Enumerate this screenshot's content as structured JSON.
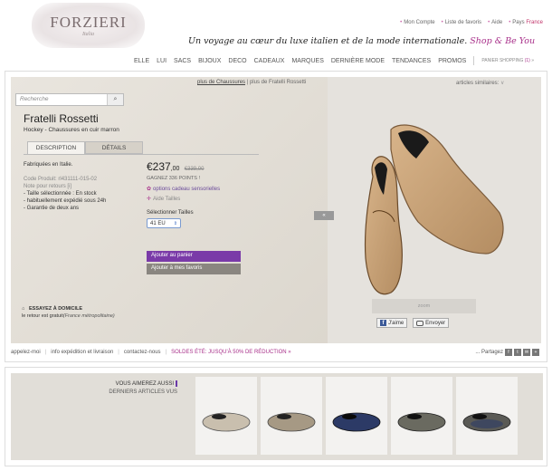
{
  "header": {
    "logo_name": "FORZIERI",
    "logo_sub": "Italia",
    "util_links": [
      "Mon Compte",
      "Liste de favoris",
      "Aide"
    ],
    "country_label": "Pays",
    "country_value": "France",
    "tagline": "Un voyage au cœur du luxe italien et de la mode internationale.",
    "tagline_accent": "Shop & Be You"
  },
  "nav": {
    "items": [
      "ELLE",
      "LUI",
      "SACS",
      "BIJOUX",
      "DECO",
      "CADEAUX",
      "MARQUES",
      "DERNIÈRE MODE",
      "TENDANCES",
      "PROMOS"
    ],
    "shipping_label": "PANIER SHOPPING",
    "shipping_count": "(1)"
  },
  "search": {
    "placeholder": "Recherche"
  },
  "breadcrumb": {
    "parent": "plus de Chaussures",
    "current": "plus de Fratelli Rossetti"
  },
  "similar": {
    "label": "articles similaires:"
  },
  "product": {
    "brand": "Fratelli Rossetti",
    "subtitle": "Hockey - Chaussures en cuir marron",
    "tabs": [
      "DESCRIPTION",
      "DÉTAILS"
    ],
    "made_in": "Fabriquées en Italie.",
    "code_label": "Code Produit:",
    "code_value": "rl431111-015-02",
    "return_note": "Note pour retours [i]",
    "bullets": [
      "- Taille sélectionnée : En stock",
      "- habituellement expédié sous 24h",
      "- Garantie de deux ans"
    ],
    "price_main": "€237",
    "price_cents": ",00",
    "price_old": "€339,00",
    "points": "GAGNEZ 336 POINTS !",
    "gift": "options cadeau sensorielles",
    "size_help": "Aide Tailles",
    "size_label": "Sélectionner Tailles",
    "size_value": "41 EU",
    "add_to_cart": "Ajouter au panier",
    "add_to_fav": "Ajouter à mes favoris",
    "home_title": "ESSAYEZ À DOMICILE",
    "home_text": "le retour est gratuit",
    "home_italic": "(France métropolitaine)"
  },
  "image_panel": {
    "collapse": "«",
    "zoom": "zoom",
    "like": "J'aime",
    "send": "Envoyer"
  },
  "footer": {
    "links": [
      "appelez-moi",
      "info expédition et livraison",
      "contactez-nous"
    ],
    "promo": "SOLDES ÉTÉ: JUSQU'À 50% DE RÉDUCTION »",
    "share": "... Partagez"
  },
  "strip": {
    "links": [
      "VOUS AIMEREZ AUSSI",
      "DERNIERS ARTICLES VUS"
    ]
  },
  "colors": {
    "accent": "#a8308a",
    "button_purple": "#7a3aa8",
    "shoe_tan": "#c9a47b"
  }
}
